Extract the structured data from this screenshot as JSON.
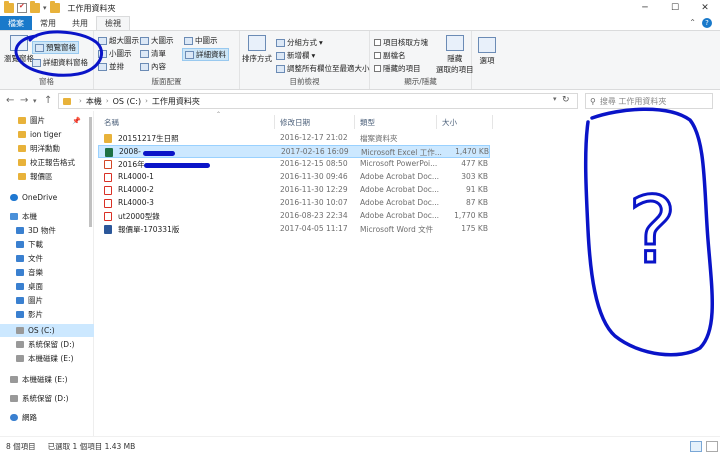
{
  "window": {
    "title": "工作用資料夾"
  },
  "ribbon_tabs": [
    "檔案",
    "常用",
    "共用",
    "檢視"
  ],
  "ribbon": {
    "pane_group": {
      "label": "窗格",
      "nav_pane": "瀏覽窗格",
      "preview_pane": "預覽窗格",
      "details_pane": "詳細資料窗格"
    },
    "layout_group": {
      "label": "版面配置",
      "items": [
        "超大圖示",
        "大圖示",
        "中圖示",
        "小圖示",
        "清單",
        "詳細資料",
        "並排",
        "內容"
      ]
    },
    "current_view_group": {
      "label": "目前檢視",
      "sort_by": "排序方式",
      "group_by": "分組方式",
      "add_columns": "新增欄",
      "size_all_columns": "調整所有欄位至最適大小"
    },
    "show_hide_group": {
      "label": "顯示/隱藏",
      "item_checkboxes": "項目核取方塊",
      "file_extensions": "副檔名",
      "hidden_items": "隱藏的項目",
      "hide_selected": "隱藏\n選取的項目"
    },
    "options": "選項"
  },
  "address": {
    "crumbs": [
      "本機",
      "OS (C:)",
      "工作用資料夾"
    ],
    "search_placeholder": "搜尋 工作用資料夾"
  },
  "nav_pane": [
    {
      "label": "圖片",
      "icon": "folder",
      "pinned": true
    },
    {
      "label": "ion tiger",
      "icon": "folder"
    },
    {
      "label": "明洋勳勳",
      "icon": "folder"
    },
    {
      "label": "校正報告格式",
      "icon": "folder"
    },
    {
      "label": "報價區",
      "icon": "folder"
    },
    {
      "label": "OneDrive",
      "icon": "onedrive"
    },
    {
      "label": "本機",
      "icon": "pc"
    },
    {
      "label": "3D 物件",
      "icon": "blue"
    },
    {
      "label": "下載",
      "icon": "blue"
    },
    {
      "label": "文件",
      "icon": "blue"
    },
    {
      "label": "音樂",
      "icon": "blue"
    },
    {
      "label": "桌面",
      "icon": "blue"
    },
    {
      "label": "圖片",
      "icon": "blue"
    },
    {
      "label": "影片",
      "icon": "blue"
    },
    {
      "label": "OS (C:)",
      "icon": "drive",
      "selected": true
    },
    {
      "label": "系統保留 (D:)",
      "icon": "drive"
    },
    {
      "label": "本機磁碟 (E:)",
      "icon": "drive"
    },
    {
      "label": "本機磁碟 (E:)",
      "icon": "drive"
    },
    {
      "label": "系統保留 (D:)",
      "icon": "drive"
    },
    {
      "label": "網路",
      "icon": "network"
    }
  ],
  "columns": [
    "名稱",
    "修改日期",
    "類型",
    "大小"
  ],
  "files": [
    {
      "name": "20151217生日照",
      "date": "2016-12-17 21:02",
      "type": "檔案資料夾",
      "size": "",
      "icon": "folder"
    },
    {
      "name": "2008-",
      "date": "2017-02-16 16:09",
      "type": "Microsoft Excel 工作...",
      "size": "1,470 KB",
      "icon": "xls",
      "selected": true
    },
    {
      "name": "2016年",
      "date": "2016-12-15 08:50",
      "type": "Microsoft PowerPoi...",
      "size": "477 KB",
      "icon": "ppt"
    },
    {
      "name": "RL4000-1",
      "date": "2016-11-30 09:46",
      "type": "Adobe Acrobat Doc...",
      "size": "303 KB",
      "icon": "pdf"
    },
    {
      "name": "RL4000-2",
      "date": "2016-11-30 12:29",
      "type": "Adobe Acrobat Doc...",
      "size": "91 KB",
      "icon": "pdf"
    },
    {
      "name": "RL4000-3",
      "date": "2016-11-30 10:07",
      "type": "Adobe Acrobat Doc...",
      "size": "87 KB",
      "icon": "pdf"
    },
    {
      "name": "ut2000型錄",
      "date": "2016-08-23 22:34",
      "type": "Adobe Acrobat Doc...",
      "size": "1,770 KB",
      "icon": "pdf"
    },
    {
      "name": "報價單-170331版",
      "date": "2017-04-05 11:17",
      "type": "Microsoft Word 文件",
      "size": "175 KB",
      "icon": "doc"
    }
  ],
  "status": {
    "count": "8 個項目",
    "selected": "已選取 1 個項目 1.43 MB"
  },
  "annotation": {
    "question_mark": "?"
  },
  "colors": {
    "accent": "#1979ca",
    "selection": "#cce8ff",
    "annotation": "#0a14c8"
  }
}
